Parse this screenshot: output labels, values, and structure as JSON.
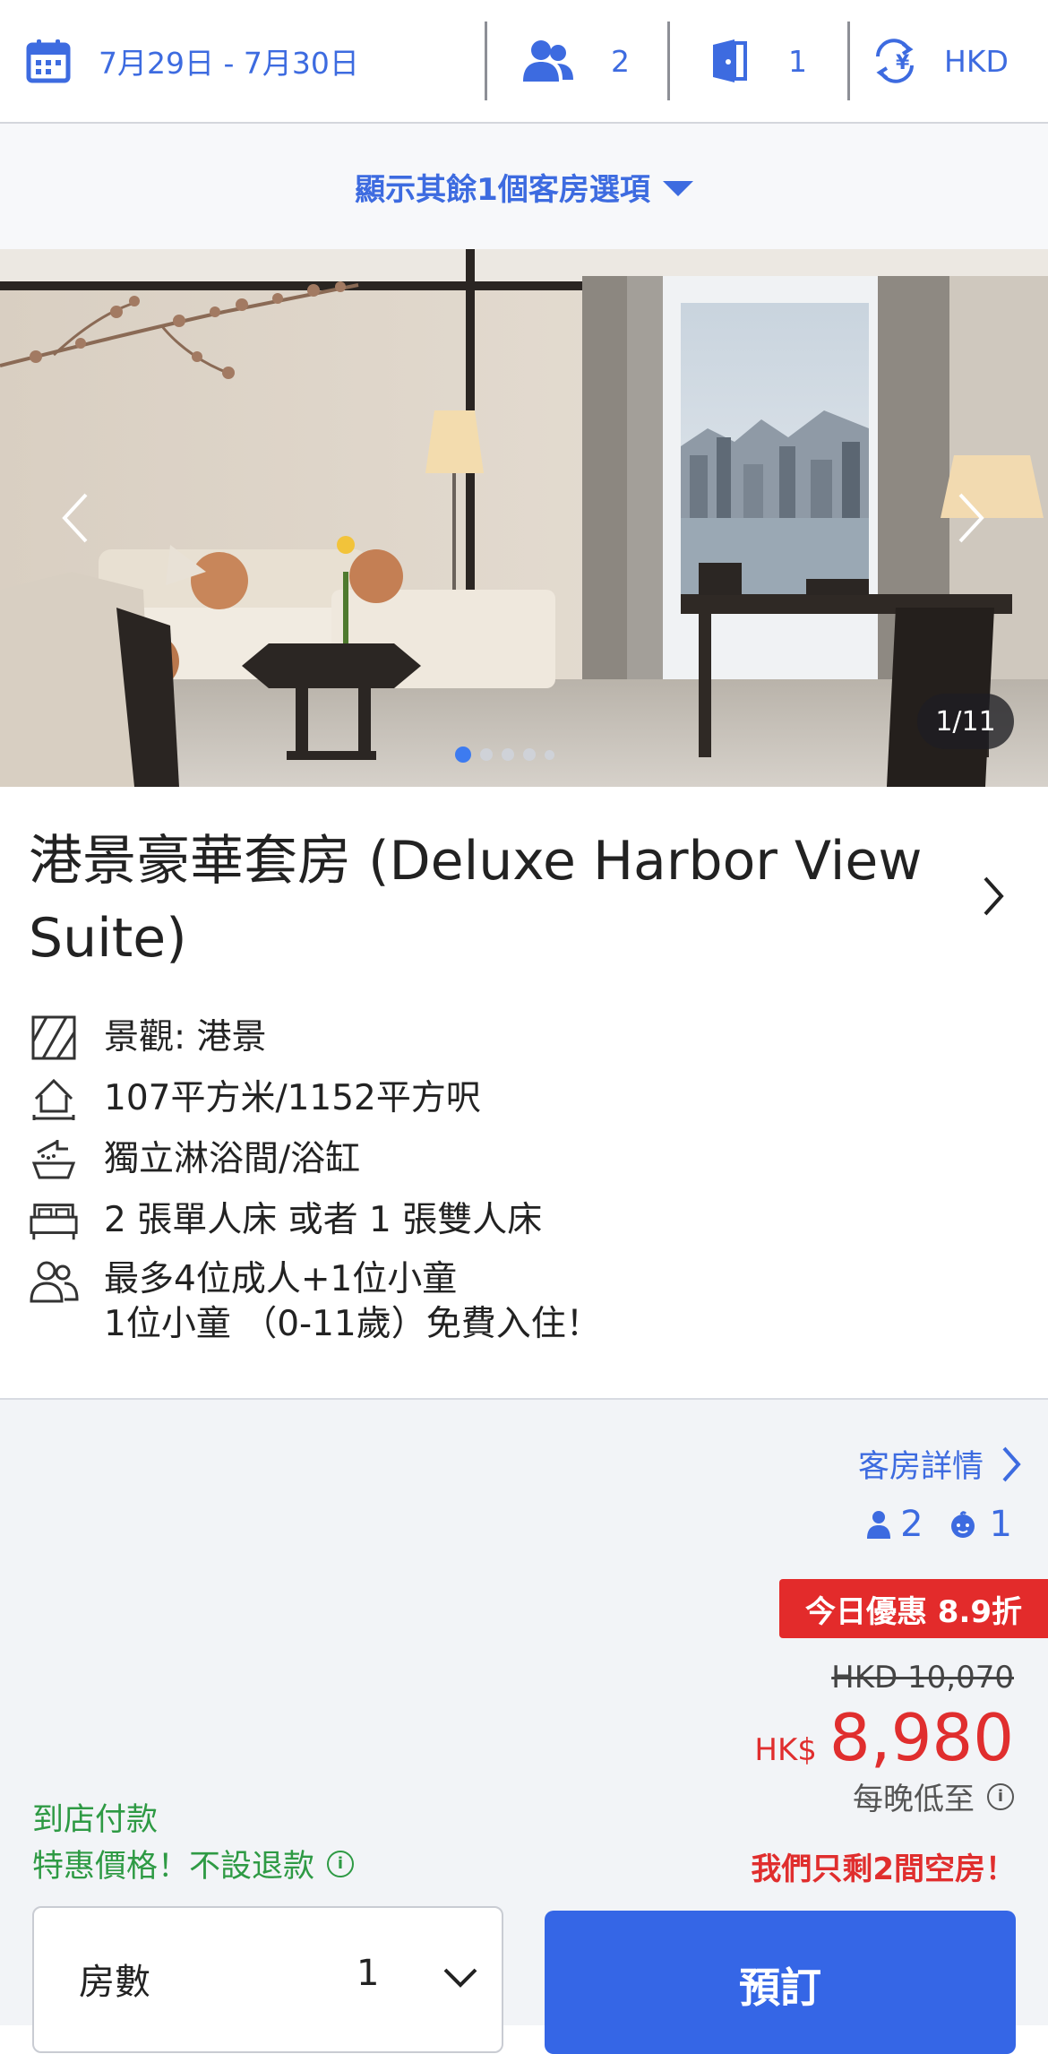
{
  "search_bar": {
    "dates": "7月29日 - 7月30日",
    "guests": "2",
    "rooms": "1",
    "currency": "HKD"
  },
  "more_options": {
    "label": "顯示其餘1個客房選項"
  },
  "gallery": {
    "counter": "1/11",
    "dot_count": 5,
    "active_dot": 1
  },
  "room": {
    "title": "港景豪華套房 (Deluxe Harbor View Suite)",
    "amenities": [
      {
        "icon": "view-icon",
        "text": "景觀: 港景"
      },
      {
        "icon": "area-icon",
        "text": "107平方米/1152平方呎"
      },
      {
        "icon": "shower-icon",
        "text": "獨立淋浴間/浴缸"
      },
      {
        "icon": "bed-icon",
        "text": "2 張單人床 或者 1 張雙人床"
      },
      {
        "icon": "people-icon",
        "text": "最多4位成人+1位小童",
        "text2": "1位小童 （0-11歲）免費入住！"
      }
    ]
  },
  "offer": {
    "details_link": "客房詳情",
    "adults": "2",
    "children": "1",
    "deal_badge": "今日優惠 8.9折",
    "original_price": "HKD 10,070",
    "currency_label": "HK$",
    "price": "8,980",
    "per_night": "每晚低至",
    "pay_at_hotel": "到店付款",
    "non_refundable": "特惠價格！不設退款",
    "rooms_left": "我們只剩2間空房！",
    "rooms_label": "房數",
    "rooms_value": "1",
    "book_button": "預訂"
  },
  "colors": {
    "accent": "#3d6be0",
    "price_red": "#e02e2e",
    "green": "#2e9a44",
    "badge_red": "#e32b2b"
  }
}
